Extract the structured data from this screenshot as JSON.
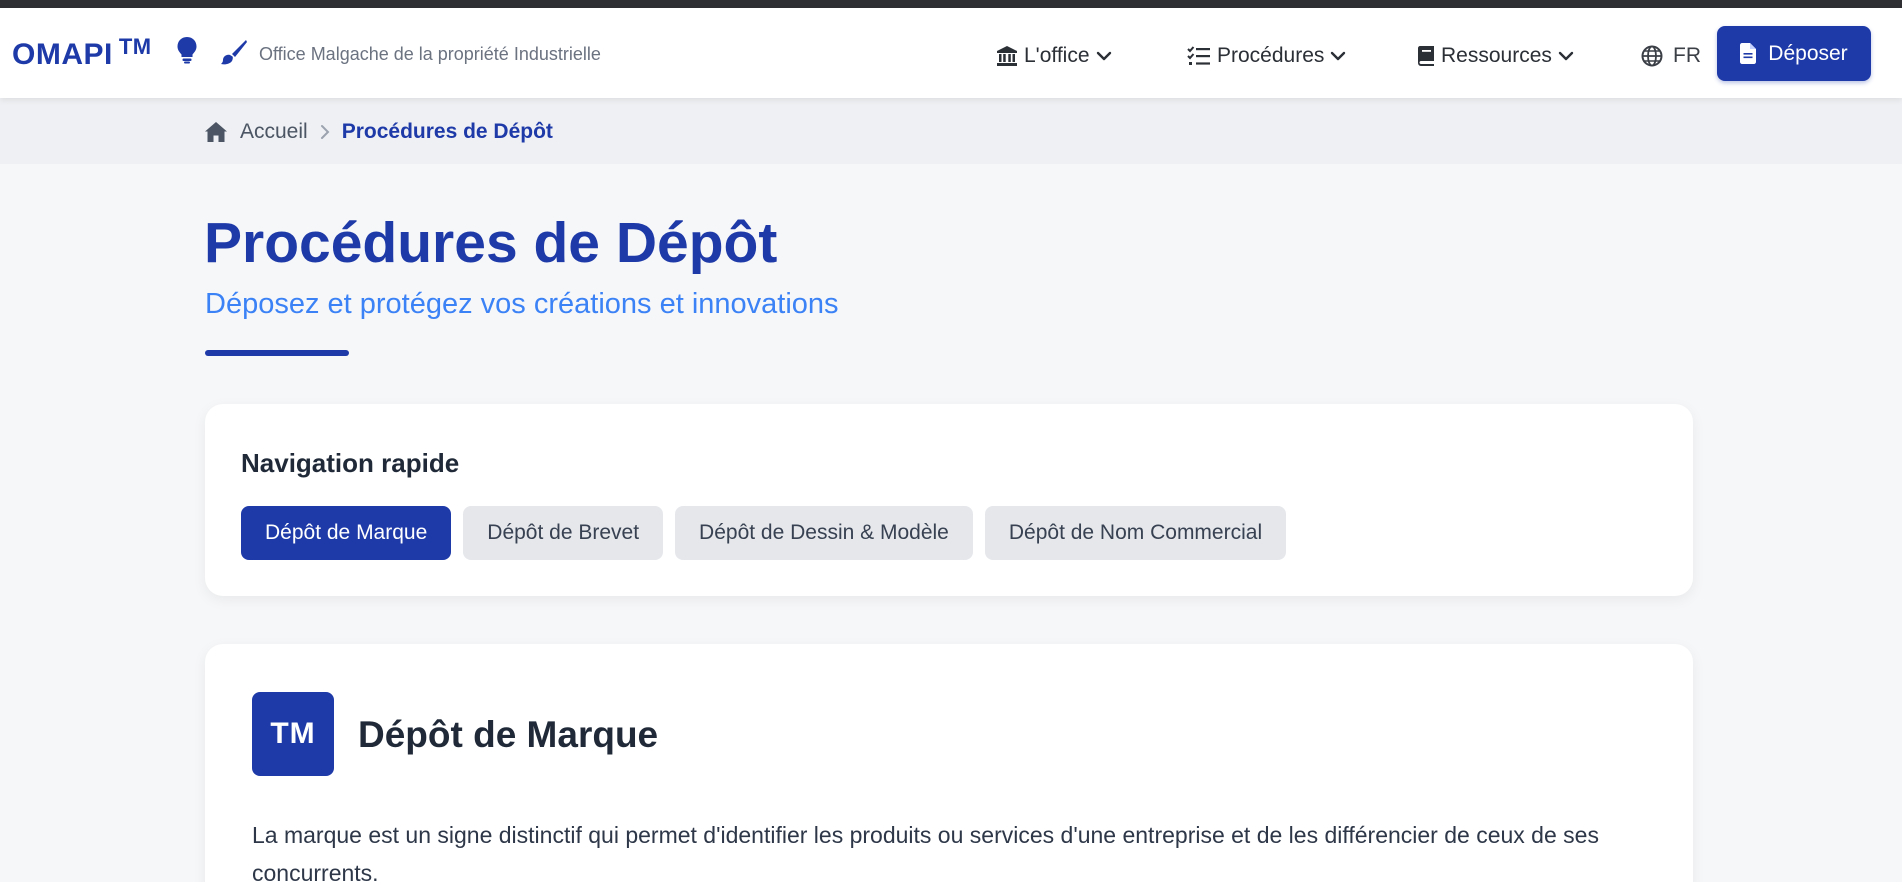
{
  "header": {
    "logo": "OMAPI",
    "logo_mark": "TM",
    "tagline": "Office Malgache de la propriété Industrielle",
    "icons": [
      "lightbulb-icon",
      "paintbrush-icon"
    ],
    "nav": {
      "office": "L'office",
      "procedures": "Procédures",
      "resources": "Ressources"
    },
    "language": "FR",
    "deposit_button": "Déposer"
  },
  "breadcrumb": {
    "home": "Accueil",
    "current": "Procédures de Dépôt"
  },
  "page": {
    "title": "Procédures de Dépôt",
    "subtitle": "Déposez et protégez vos créations et innovations"
  },
  "quick_nav": {
    "title": "Navigation rapide",
    "items": [
      {
        "label": "Dépôt de Marque",
        "active": true
      },
      {
        "label": "Dépôt de Brevet",
        "active": false
      },
      {
        "label": "Dépôt de Dessin & Modèle",
        "active": false
      },
      {
        "label": "Dépôt de Nom Commercial",
        "active": false
      }
    ]
  },
  "section": {
    "badge": "TM",
    "title": "Dépôt de Marque",
    "description": "La marque est un signe distinctif qui permet d'identifier les produits ou services d'une entreprise et de les différencier de ceux de ses concurrents."
  },
  "colors": {
    "primary": "#1e3aa8",
    "accent": "#3b82f6",
    "chip": "#e5e7eb",
    "background": "#f6f7f9"
  }
}
